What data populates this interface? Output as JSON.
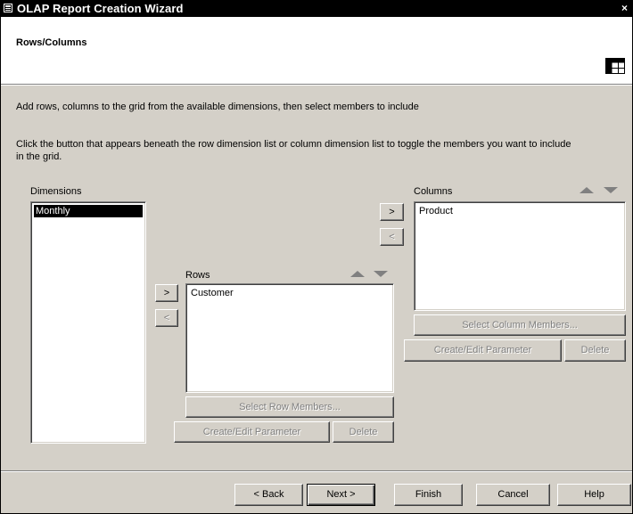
{
  "window": {
    "title": "OLAP Report Creation Wizard",
    "close_glyph": "×"
  },
  "header": {
    "heading": "Rows/Columns",
    "icon": "grid-icon"
  },
  "instructions": {
    "line1": "Add rows, columns to the grid from the available dimensions, then select members to include",
    "line2a": "Click the button that appears beneath the row dimension list or column dimension list to toggle the members you want to include",
    "line2b": "in the grid."
  },
  "dimensions": {
    "label": "Dimensions",
    "items": [
      "Monthly"
    ],
    "selected": "Monthly"
  },
  "rows": {
    "label": "Rows",
    "items": [
      "Customer"
    ],
    "add_label": ">",
    "remove_label": "<",
    "select_members_label": "Select Row Members...",
    "create_edit_label": "Create/Edit Parameter",
    "delete_label": "Delete"
  },
  "columns": {
    "label": "Columns",
    "items": [
      "Product"
    ],
    "add_label": ">",
    "remove_label": "<",
    "select_members_label": "Select Column Members...",
    "create_edit_label": "Create/Edit Parameter",
    "delete_label": "Delete"
  },
  "footer": {
    "back_label": "< Back",
    "next_label": "Next >",
    "finish_label": "Finish",
    "cancel_label": "Cancel",
    "help_label": "Help"
  },
  "colors": {
    "title_bg": "#000000",
    "dialog_bg": "#d4d0c8",
    "selection_bg": "#000000",
    "disabled_text": "#808080"
  }
}
